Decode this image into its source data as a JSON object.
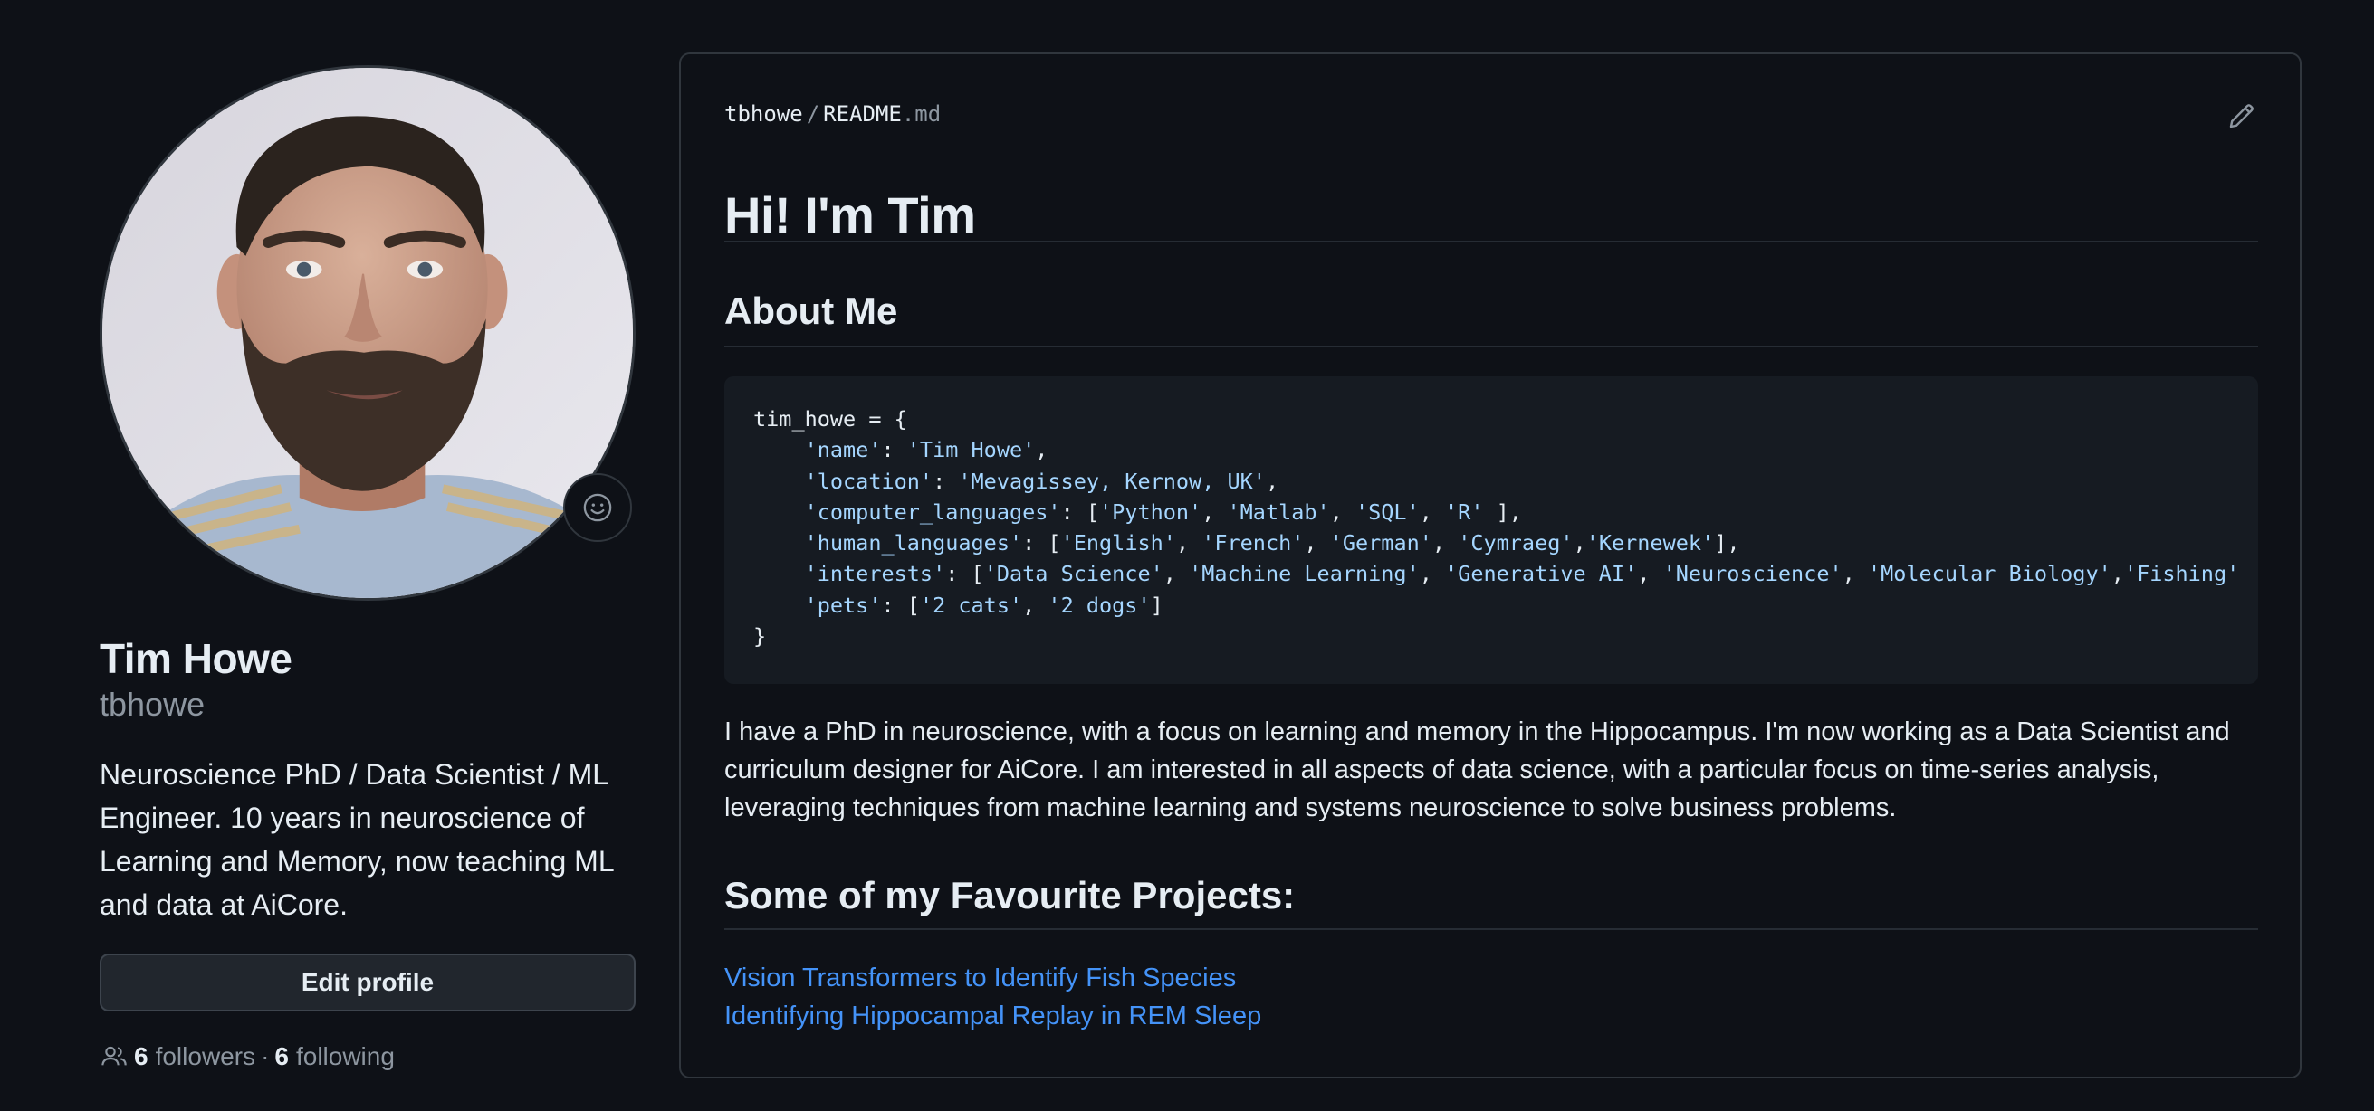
{
  "profile": {
    "name": "Tim Howe",
    "login": "tbhowe",
    "bio": "Neuroscience PhD / Data Scientist / ML Engineer. 10 years in neuroscience of Learning and Memory, now teaching ML and data at AiCore.",
    "edit_button": "Edit profile",
    "followers_count": "6",
    "followers_label": "followers",
    "separator": "·",
    "following_count": "6",
    "following_label": "following",
    "icons": [
      "people-icon",
      "smiley-icon"
    ]
  },
  "readme": {
    "crumb_owner": "tbhowe",
    "crumb_sep": "/",
    "crumb_file": "README",
    "crumb_ext": ".md",
    "title": "Hi! I'm Tim",
    "about_heading": "About Me",
    "code": {
      "open": "tim_howe = {",
      "close": "}",
      "name_line": [
        "'name'",
        "'Tim Howe'"
      ],
      "location_line": [
        "'location'",
        "'Mevagissey, Kernow, UK'"
      ],
      "computer_languages": [
        "'computer_languages'",
        "'Python'",
        "'Matlab'",
        "'SQL'",
        "'R'"
      ],
      "human_languages": [
        "'human_languages'",
        "'English'",
        "'French'",
        "'German'",
        "'Cymraeg'",
        "'Kernewek'"
      ],
      "interests": [
        "'interests'",
        "'Data Science'",
        "'Machine Learning'",
        "'Generative AI'",
        "'Neuroscience'",
        "'Molecular Biology'",
        "'Fishing'"
      ],
      "pets": [
        "'pets'",
        "'2 cats'",
        "'2 dogs'"
      ]
    },
    "paragraph": "I have a PhD in neuroscience, with a focus on learning and memory in the Hippocampus. I'm now working as a Data Scientist and curriculum designer for AiCore. I am interested in all aspects of data science, with a particular focus on time-series analysis, leveraging techniques from machine learning and systems neuroscience to solve business problems.",
    "projects_heading": "Some of my Favourite Projects:",
    "projects": [
      "Vision Transformers to Identify Fish Species",
      "Identifying Hippocampal Replay in REM Sleep"
    ]
  },
  "colors": {
    "background": "#0e1117",
    "border": "#30363d",
    "link": "#4493f8",
    "code_bg": "#161b22",
    "code_string": "#a5d6ff"
  }
}
